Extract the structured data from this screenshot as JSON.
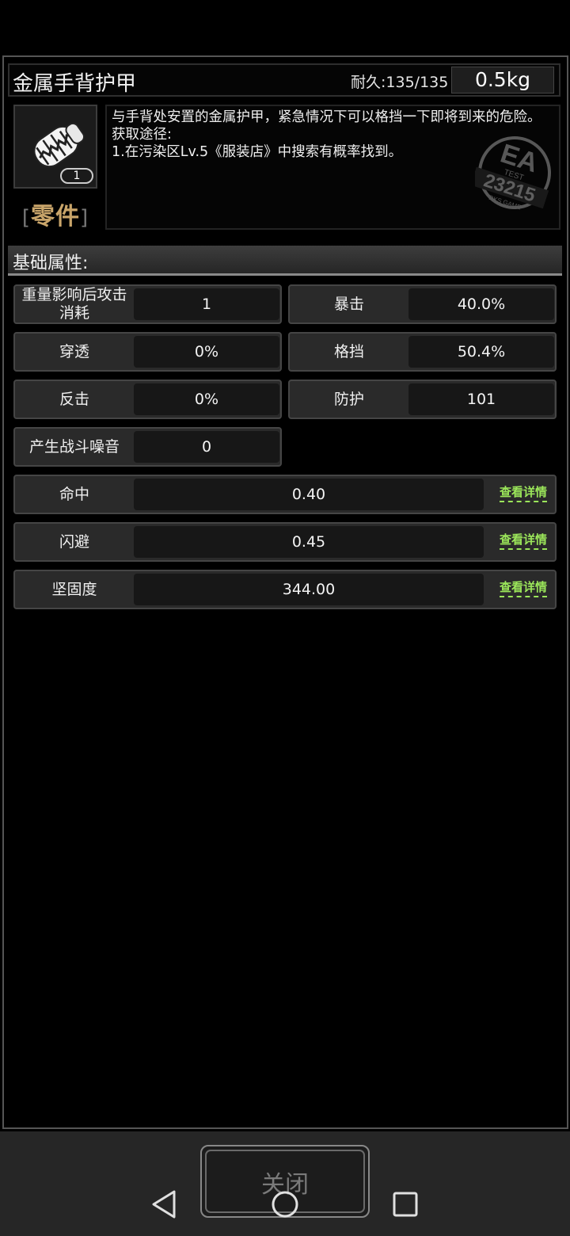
{
  "item": {
    "name": "金属手背护甲",
    "durability": "耐久:135/135",
    "weight": "0.5kg",
    "count": "1",
    "type_label": "零件",
    "type_left_bracket": "[",
    "type_right_bracket": "]",
    "description": "与手背处安置的金属护甲，紧急情况下可以格挡一下即将到来的危险。\n获取途径:\n1.在污染区Lv.5《服装店》中搜索有概率找到。"
  },
  "watermark": {
    "line1": "EA",
    "line2": "TEST",
    "line3": "23215",
    "line4": "DKS GAME"
  },
  "section": {
    "title": "基础属性:"
  },
  "stats": {
    "weight_attack_cost": {
      "label": "重量影响后攻击\n消耗",
      "value": "1"
    },
    "crit": {
      "label": "暴击",
      "value": "40.0%"
    },
    "pierce": {
      "label": "穿透",
      "value": "0%"
    },
    "block": {
      "label": "格挡",
      "value": "50.4%"
    },
    "counter": {
      "label": "反击",
      "value": "0%"
    },
    "defense": {
      "label": "防护",
      "value": "101"
    },
    "noise": {
      "label": "产生战斗噪音",
      "value": "0"
    },
    "hit": {
      "label": "命中",
      "value": "0.40",
      "detail": "查看详情"
    },
    "dodge": {
      "label": "闪避",
      "value": "0.45",
      "detail": "查看详情"
    },
    "toughness": {
      "label": "坚固度",
      "value": "344.00",
      "detail": "查看详情"
    }
  },
  "footer": {
    "close_label": "关闭"
  },
  "colors": {
    "detail_link": "#9be65a",
    "type_label": "#c9a56a"
  },
  "icons": {
    "item": "metal-gauntlet-icon",
    "nav_back": "back-triangle-icon",
    "nav_home": "home-circle-icon",
    "nav_recent": "recent-square-icon"
  }
}
